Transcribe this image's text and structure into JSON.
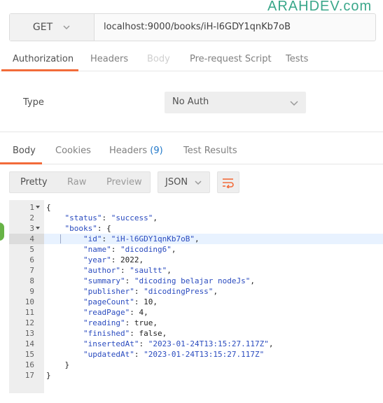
{
  "watermark": "ARAHDEV.com",
  "request": {
    "method": "GET",
    "url": "localhost:9000/books/iH-l6GDY1qnKb7oB"
  },
  "request_tabs": [
    "Authorization",
    "Headers",
    "Body",
    "Pre-request Script",
    "Tests"
  ],
  "auth": {
    "type_label": "Type",
    "selected": "No Auth"
  },
  "response_tabs": {
    "body": "Body",
    "cookies": "Cookies",
    "headers": "Headers",
    "headers_count": "(9)",
    "test_results": "Test Results"
  },
  "view": {
    "pretty": "Pretty",
    "raw": "Raw",
    "preview": "Preview",
    "format": "JSON"
  },
  "colors": {
    "accent": "#f26b3a",
    "string": "#2a4bbf",
    "count": "#1f77c9",
    "watermark": "#3aa78a"
  },
  "code": {
    "highlighted_line": 4,
    "folded_lines": [
      1,
      3
    ],
    "lines": [
      "{",
      "    \"status\": \"success\",",
      "    \"books\": {",
      "        \"id\": \"iH-l6GDY1qnKb7oB\",",
      "        \"name\": \"dicoding6\",",
      "        \"year\": 2022,",
      "        \"author\": \"saultt\",",
      "        \"summary\": \"dicoding belajar nodeJs\",",
      "        \"publisher\": \"dicodingPress\",",
      "        \"pageCount\": 10,",
      "        \"readPage\": 4,",
      "        \"reading\": true,",
      "        \"finished\": false,",
      "        \"insertedAt\": \"2023-01-24T13:15:27.117Z\",",
      "        \"updatedAt\": \"2023-01-24T13:15:27.117Z\"",
      "    }",
      "}"
    ]
  }
}
